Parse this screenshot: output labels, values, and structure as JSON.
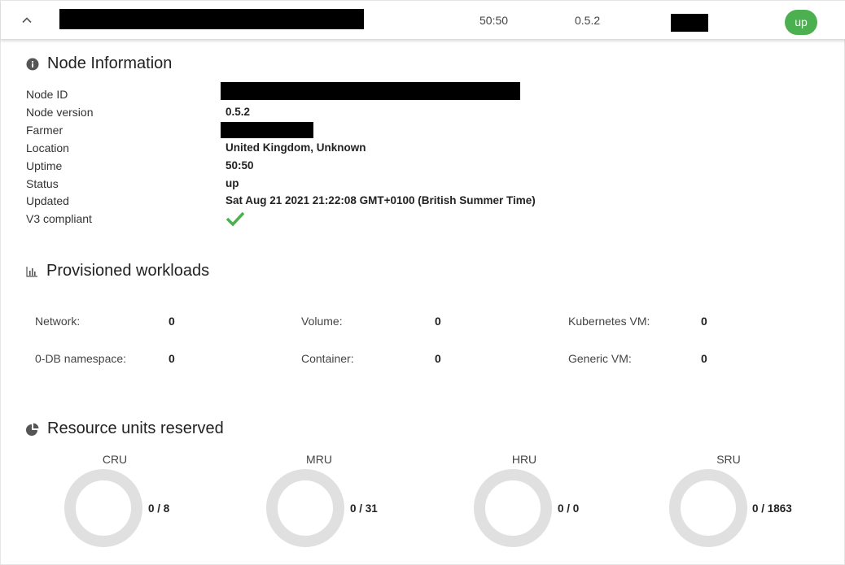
{
  "header": {
    "uptime": "50:50",
    "version": "0.5.2",
    "status": "up"
  },
  "node_info": {
    "title": "Node Information",
    "icon": "info-icon",
    "rows": [
      {
        "label": "Node ID",
        "value": ""
      },
      {
        "label": "Node version",
        "value": "0.5.2"
      },
      {
        "label": "Farmer",
        "value": ""
      },
      {
        "label": "Location",
        "value": "United Kingdom, Unknown"
      },
      {
        "label": "Uptime",
        "value": "50:50"
      },
      {
        "label": "Status",
        "value": "up"
      },
      {
        "label": "Updated",
        "value": "Sat Aug 21 2021 21:22:08 GMT+0100 (British Summer Time)"
      },
      {
        "label": "V3 compliant",
        "value": ""
      }
    ],
    "v3_compliant": true
  },
  "workloads": {
    "title": "Provisioned workloads",
    "icon": "bar-chart-icon",
    "items": [
      {
        "label": "Network:",
        "value": "0"
      },
      {
        "label": "Volume:",
        "value": "0"
      },
      {
        "label": "Kubernetes VM:",
        "value": "0"
      },
      {
        "label": "0-DB namespace:",
        "value": "0"
      },
      {
        "label": "Container:",
        "value": "0"
      },
      {
        "label": "Generic VM:",
        "value": "0"
      }
    ]
  },
  "resources": {
    "title": "Resource units reserved",
    "icon": "pie-chart-icon",
    "units": [
      {
        "label": "CRU",
        "value": "0 / 8",
        "reserved": 0,
        "total": 8
      },
      {
        "label": "MRU",
        "value": "0 / 31",
        "reserved": 0,
        "total": 31
      },
      {
        "label": "HRU",
        "value": "0 / 0",
        "reserved": 0,
        "total": 0
      },
      {
        "label": "SRU",
        "value": "0 / 1863",
        "reserved": 0,
        "total": 1863
      }
    ]
  },
  "colors": {
    "status_up": "#4caf50",
    "check": "#4caf50",
    "donut_track": "#e0e0e0"
  }
}
